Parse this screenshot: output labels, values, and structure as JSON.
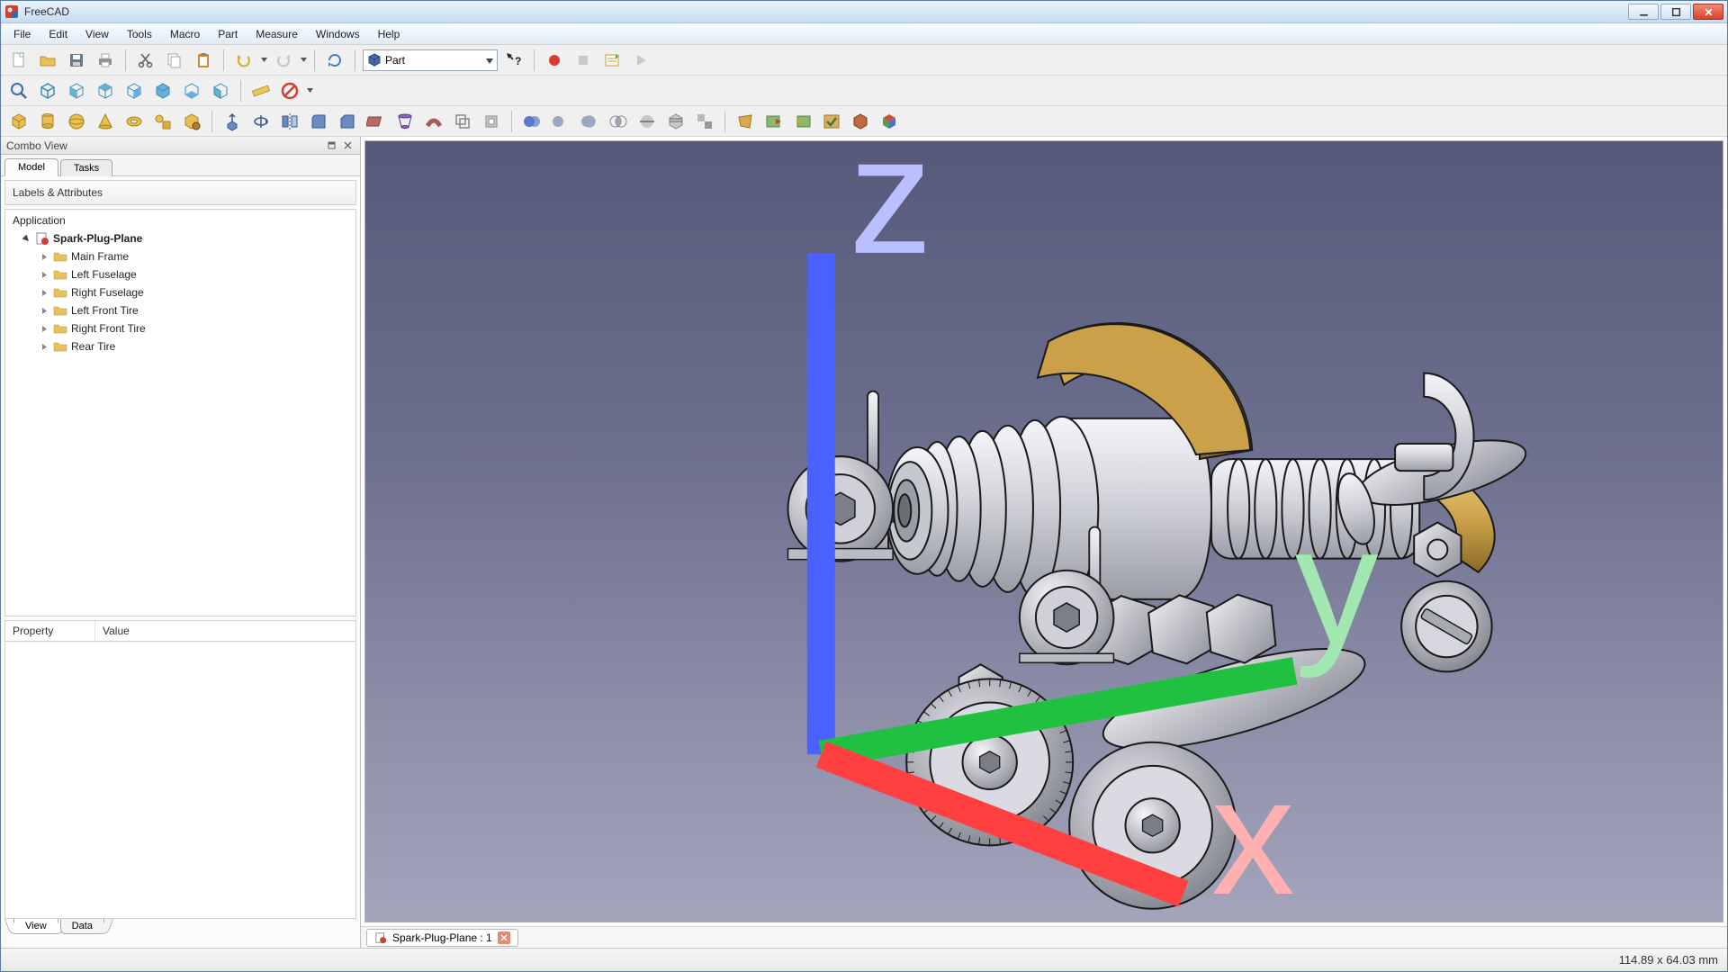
{
  "app": {
    "title": "FreeCAD"
  },
  "menu": [
    "File",
    "Edit",
    "View",
    "Tools",
    "Macro",
    "Part",
    "Measure",
    "Windows",
    "Help"
  ],
  "workbench_selector": {
    "value": "Part"
  },
  "combo": {
    "title": "Combo View",
    "tabs": {
      "model": "Model",
      "tasks": "Tasks"
    },
    "labels_header": "Labels & Attributes",
    "root": "Application",
    "document": "Spark-Plug-Plane",
    "items": [
      "Main Frame",
      "Left Fuselage",
      "Right Fuselage",
      "Left Front Tire",
      "Right Front Tire",
      "Rear Tire"
    ],
    "prop_headers": {
      "property": "Property",
      "value": "Value"
    },
    "bottom_tabs": {
      "view": "View",
      "data": "Data"
    }
  },
  "document_tab": {
    "label": "Spark-Plug-Plane : 1"
  },
  "status": {
    "dimensions": "114.89 x 64.03 mm"
  },
  "axis": {
    "x": "x",
    "y": "y",
    "z": "z"
  },
  "colors": {
    "brass": "#c9a24a",
    "brass_dark": "#9a7a2e",
    "metal_light": "#e6e6ea",
    "metal_mid": "#b8bac0",
    "metal_dark": "#6a6c74"
  }
}
